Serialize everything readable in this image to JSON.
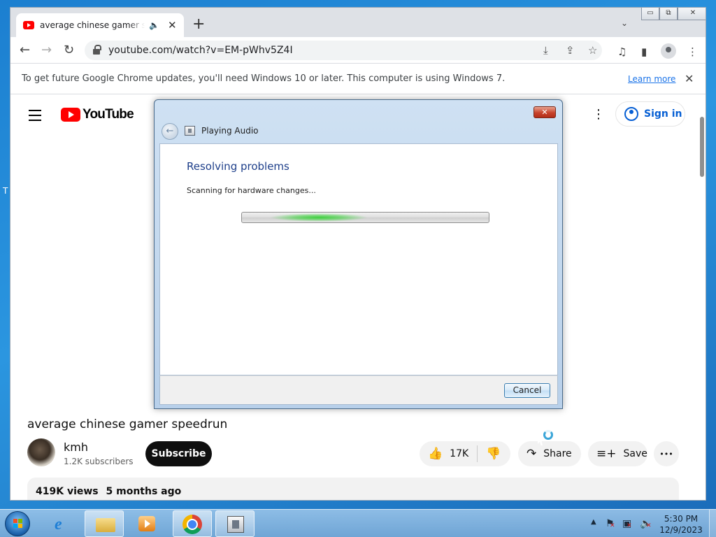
{
  "desktop": {
    "edge_glyph": "T"
  },
  "browser": {
    "tab": {
      "title": "average chinese gamer speedrun - YouTube",
      "audio_icon": "speaker-icon",
      "close": "✕"
    },
    "new_tab": "+",
    "tab_search": "⌄",
    "window_controls": {
      "minimize": "▭",
      "restore": "⧉",
      "close": "✕"
    },
    "nav": {
      "back": "←",
      "forward": "→",
      "reload": "↻"
    },
    "url": "youtube.com/watch?v=EM-pWhv5Z4I",
    "toolbar_icons": {
      "install": "⤓",
      "share": "⇪",
      "bookmark": "☆",
      "media": "♫",
      "sidepanel": "▮",
      "menu": "⋮"
    },
    "infobar": {
      "text": "To get future Google Chrome updates, you'll need Windows 10 or later. This computer is using Windows 7.",
      "link": "Learn more",
      "close": "✕"
    }
  },
  "youtube": {
    "logo_text": "YouTube",
    "more": "⋮",
    "signin_label": "Sign in",
    "video_title": "average chinese gamer speedrun",
    "channel": {
      "name": "kmh",
      "subscribers": "1.2K subscribers"
    },
    "subscribe_label": "Subscribe",
    "like_count": "17K",
    "like_icon": "👍",
    "dislike_icon": "👎",
    "share_label": "Share",
    "share_icon": "↷",
    "save_label": "Save",
    "save_icon": "≡+",
    "more_actions": "•••",
    "views": "419K views",
    "age": "5 months ago"
  },
  "dialog": {
    "close": "✕",
    "back": "←",
    "caption": "Playing Audio",
    "heading": "Resolving problems",
    "status": "Scanning for hardware changes...",
    "progress_indeterminate": true,
    "cancel_label": "Cancel"
  },
  "taskbar": {
    "apps": [
      {
        "name": "internet-explorer",
        "active": false
      },
      {
        "name": "file-explorer",
        "active": true
      },
      {
        "name": "windows-media-player",
        "active": false
      },
      {
        "name": "google-chrome",
        "active": true
      },
      {
        "name": "troubleshooter",
        "active": true
      }
    ],
    "tray": {
      "show_hidden": "▲"
    },
    "clock": {
      "time": "5:30 PM",
      "date": "12/9/2023"
    }
  },
  "colors": {
    "youtube_red": "#ff0000",
    "link_blue": "#065fd4",
    "dialog_heading": "#1e3f8a",
    "progress_green": "#3fd13f"
  }
}
